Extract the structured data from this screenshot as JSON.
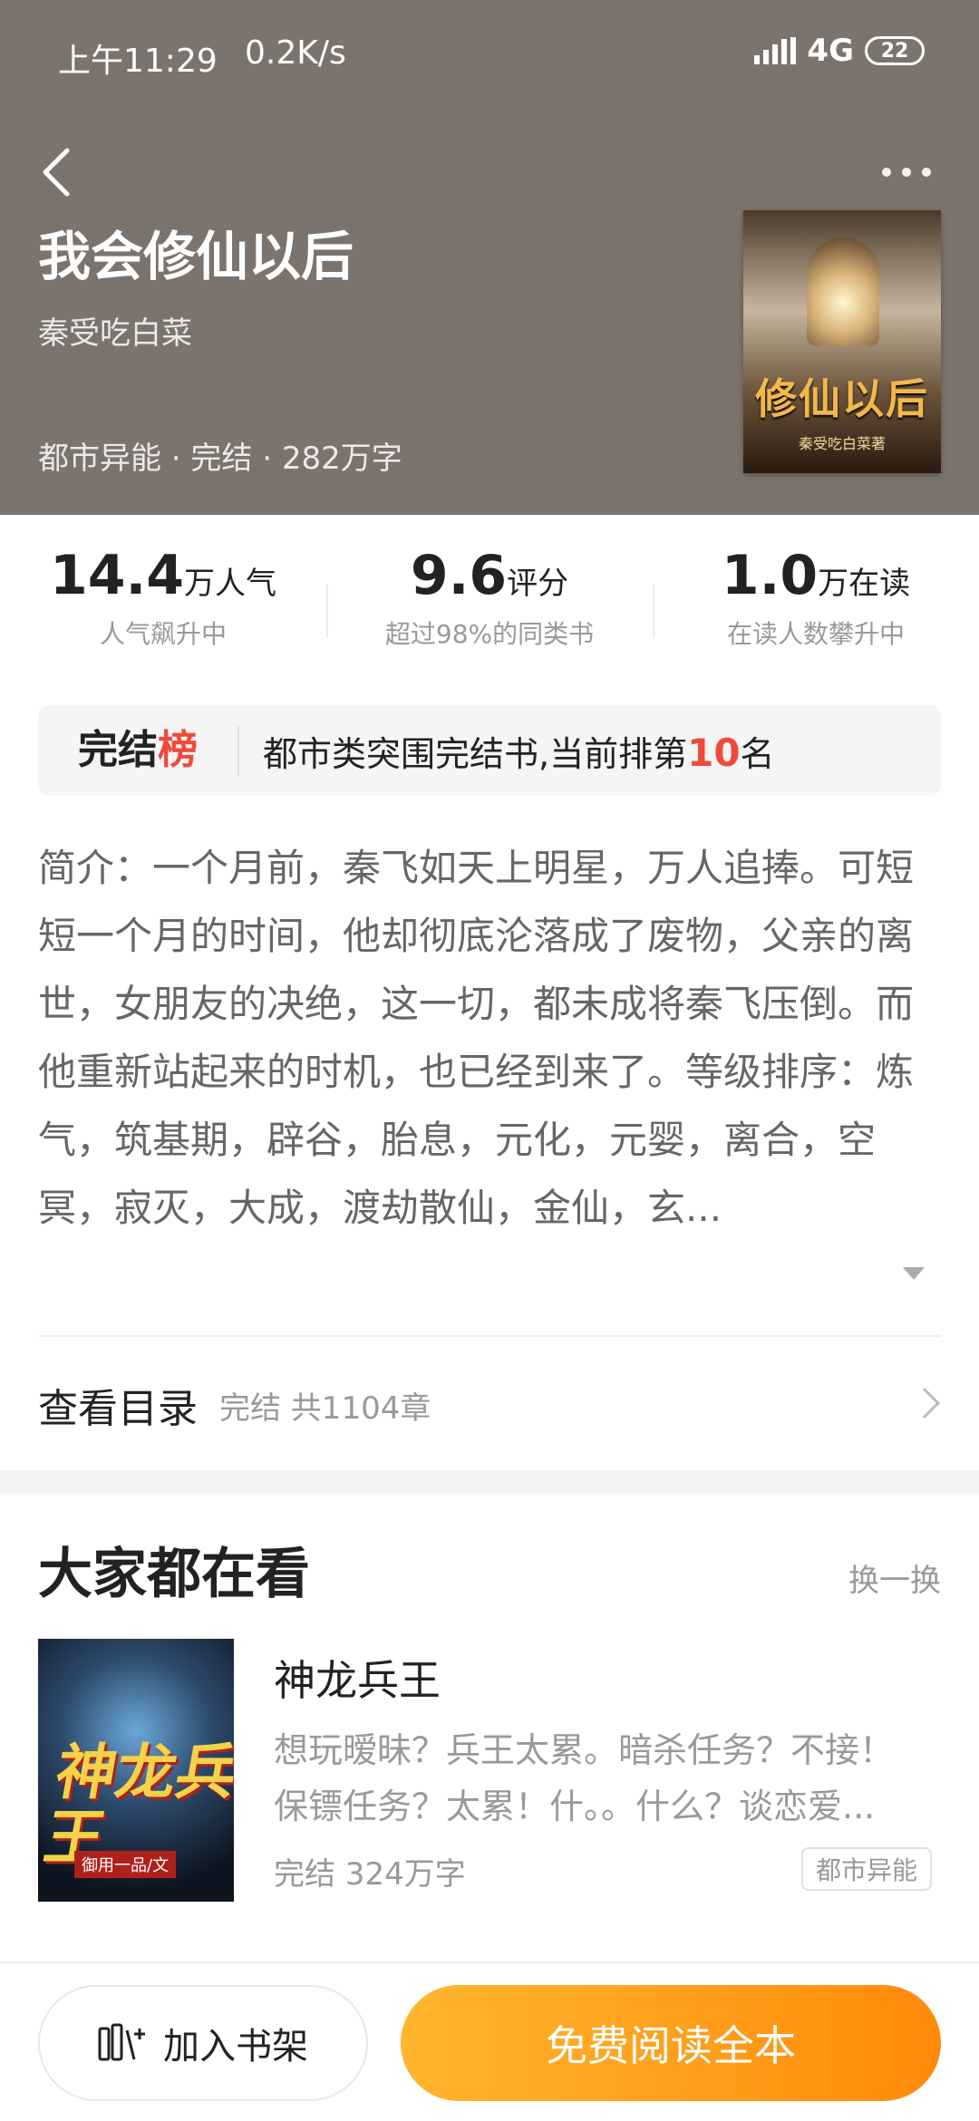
{
  "status_bar": {
    "time": "上午11:29",
    "speed": "0.2K/s",
    "network": "4G",
    "battery": "22"
  },
  "book": {
    "title": "我会修仙以后",
    "author": "秦受吃白菜",
    "meta": "都市异能 · 完结 · 282万字",
    "cover_title": "修仙以后",
    "cover_author": "秦受吃白菜著"
  },
  "stats": [
    {
      "value": "14.4",
      "unit": "万人气",
      "sub": "人气飙升中"
    },
    {
      "value": "9.6",
      "unit": "评分",
      "sub": "超过98%的同类书"
    },
    {
      "value": "1.0",
      "unit": "万在读",
      "sub": "在读人数攀升中"
    }
  ],
  "rank": {
    "tag_part1": "完结",
    "tag_part2": "榜",
    "text_before": "都市类突围完结书,当前排第",
    "rank_number": "10",
    "text_after": "名"
  },
  "intro": "简介：一个月前，秦飞如天上明星，万人追捧。可短短一个月的时间，他却彻底沦落成了废物，父亲的离世，女朋友的决绝，这一切，都未成将秦飞压倒。而他重新站起来的时机，也已经到来了。等级排序：炼气，筑基期，辟谷，胎息，元化，元婴，离合，空冥，寂灭，大成，渡劫散仙，金仙，玄...",
  "toc": {
    "label": "查看目录",
    "sub": "完结 共1104章"
  },
  "recommend": {
    "title": "大家都在看",
    "refresh": "换一换",
    "book": {
      "title": "神龙兵王",
      "desc": "想玩暧昧？兵王太累。暗杀任务？不接！保镖任务？太累！什。。什么？谈恋爱...",
      "meta": "完结  324万字",
      "tag": "都市异能",
      "cover_title": "神龙兵王",
      "cover_author": "御用一品/文"
    }
  },
  "actions": {
    "shelf": "加入书架",
    "read": "免费阅读全本"
  },
  "colors": {
    "header_bg": "#7c746c",
    "accent": "#ff8a0a",
    "rank_red": "#f04a3a"
  }
}
